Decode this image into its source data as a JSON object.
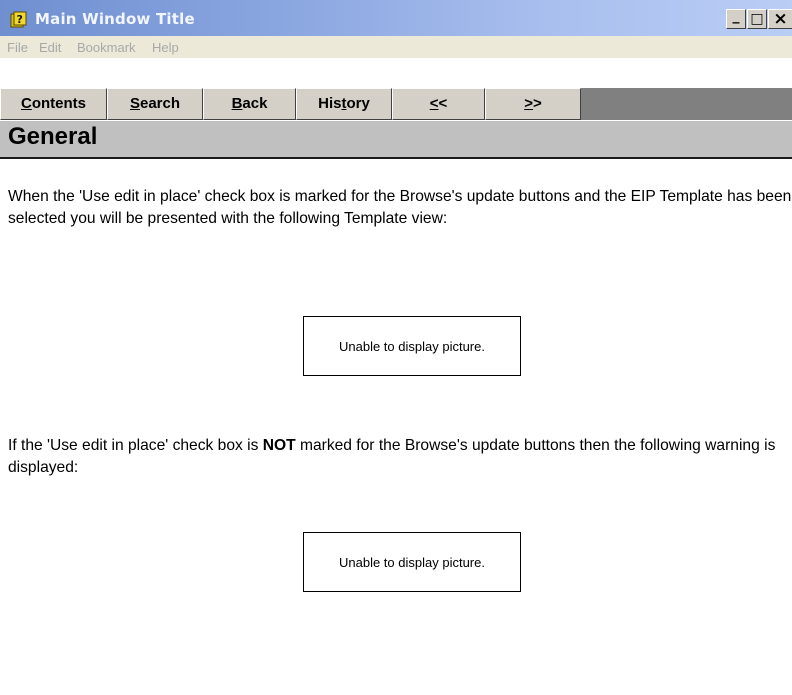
{
  "window": {
    "title": "Main Window Title",
    "controls": {
      "minimize": "_",
      "maximize": "□",
      "close": "×"
    }
  },
  "menu": [
    "File",
    "Edit",
    "Bookmark",
    "Help"
  ],
  "nav_buttons": [
    {
      "pre": "",
      "u": "C",
      "post": "ontents"
    },
    {
      "pre": "",
      "u": "S",
      "post": "earch"
    },
    {
      "pre": "",
      "u": "B",
      "post": "ack"
    },
    {
      "pre": "His",
      "u": "t",
      "post": "ory"
    },
    {
      "pre": "",
      "u": "<",
      "post": "<"
    },
    {
      "pre": "",
      "u": ">",
      "post": ">"
    }
  ],
  "page": {
    "heading": "General",
    "para1": "When the 'Use edit in place' check box is marked for the Browse's update buttons and the EIP Template has been selected you will be presented with the following Template view:",
    "picture_placeholder_1": "Unable to display picture.",
    "para2_before": "If the 'Use edit in place' check box is ",
    "para2_bold": "NOT",
    "para2_after": " marked for the Browse's update buttons then the following warning is displayed:",
    "picture_placeholder_2": "Unable to display picture."
  }
}
